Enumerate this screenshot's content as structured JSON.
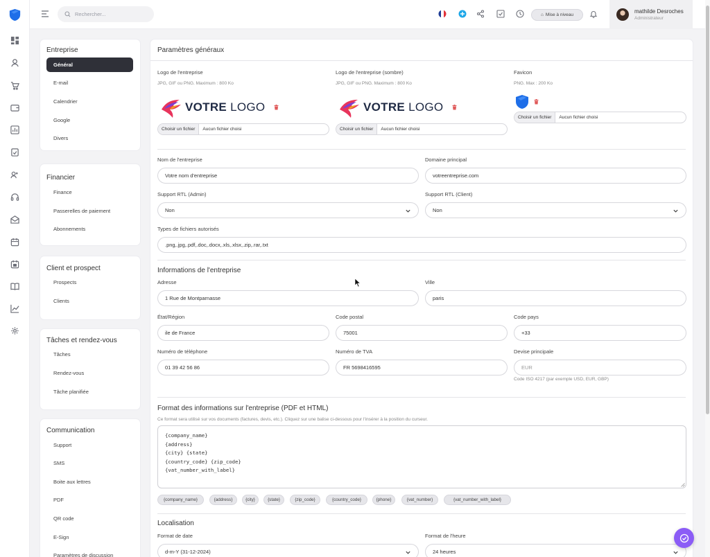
{
  "colors": {
    "accent": "#2f3038",
    "brand_blue": "#1e6ee8",
    "fab": "#8b5cf6",
    "danger": "#e05a5a",
    "upgrade_bg": "#e9e9ed"
  },
  "topbar": {
    "search_placeholder": "Rechercher...",
    "icons": [
      "flag-fr-icon",
      "plus-circle-icon",
      "share-icon",
      "check-square-icon",
      "clock-icon",
      "bell-icon"
    ],
    "upgrade_label": "Mise à niveau",
    "user": {
      "name": "mathilde Desroches",
      "role": "Administrateur"
    }
  },
  "rail": {
    "icons": [
      "dashboard-icon",
      "user-icon",
      "cart-icon",
      "wallet-icon",
      "chart-box-icon",
      "clipboard-check-icon",
      "users-icon",
      "headset-icon",
      "mail-open-icon",
      "calendar-icon",
      "calendar-check-icon",
      "book-icon",
      "line-chart-icon",
      "gear-icon"
    ]
  },
  "nav": {
    "groups": [
      {
        "title": "Entreprise",
        "items": [
          "Général",
          "E-mail",
          "Calendrier",
          "Google",
          "Divers"
        ]
      },
      {
        "title": "Financier",
        "items": [
          "Finance",
          "Passerelles de paiement",
          "Abonnements"
        ]
      },
      {
        "title": "Client et prospect",
        "items": [
          "Prospects",
          "Clients"
        ]
      },
      {
        "title": "Tâches et rendez-vous",
        "items": [
          "Tâches",
          "Rendez-vous",
          "Tâche planifiée"
        ]
      },
      {
        "title": "Communication",
        "items": [
          "Support",
          "SMS",
          "Boite aux lettres",
          "PDF",
          "QR code",
          "E-Sign",
          "Paramètres de discussion"
        ]
      }
    ]
  },
  "main": {
    "title": "Paramètres généraux",
    "logos": {
      "company_logo": {
        "label": "Logo de l'entreprise",
        "hint": "JPG, GIF ou PNG. Maximum : 800 Ko"
      },
      "company_logo_dark": {
        "label": "Logo de l'entreprise (sombre)",
        "hint": "JPG, GIF ou PNG. Maximum : 800 Ko"
      },
      "favicon": {
        "label": "Favicon",
        "hint": "PNG. Max : 200 Ko"
      },
      "logo_text_bold": "VOTRE",
      "logo_text_light": "LOGO",
      "file_button": "Choisir un fichier",
      "file_none": "Aucun fichier choisi"
    },
    "fields": {
      "company_name": {
        "label": "Nom de l'entreprise",
        "value": "Votre nom d'entreprise"
      },
      "main_domain": {
        "label": "Domaine principal",
        "value": "votreentreprise.com"
      },
      "rtl_admin": {
        "label": "Support RTL (Admin)",
        "value": "Non"
      },
      "rtl_client": {
        "label": "Support RTL (Client)",
        "value": "Non"
      },
      "file_types": {
        "label": "Types de fichiers autorisés",
        "value": ".png,.jpg,.pdf,.doc,.docx,.xls,.xlsx,.zip,.rar,.txt"
      }
    },
    "company_info": {
      "title": "Informations de l'entreprise",
      "address": {
        "label": "Adresse",
        "value": "1 Rue de Montparnasse"
      },
      "city": {
        "label": "Ville",
        "value": "paris"
      },
      "state": {
        "label": "État/Région",
        "value": "ile de France"
      },
      "zip": {
        "label": "Code postal",
        "value": "75001"
      },
      "country_code": {
        "label": "Code pays",
        "value": "+33"
      },
      "phone": {
        "label": "Numéro de téléphone",
        "value": "01 39 42 56 86"
      },
      "vat": {
        "label": "Numéro de TVA",
        "value": "FR 5698416595"
      },
      "currency": {
        "label": "Devise principale",
        "placeholder": "EUR",
        "hint": "Code ISO 4217 (par exemple USD, EUR, GBP)"
      }
    },
    "format": {
      "title": "Format des informations sur l'entreprise (PDF et HTML)",
      "hint": "Ce format sera utilisé sur vos documents (factures, devis, etc.). Cliquez sur une balise ci-dessous pour l'insérer à la position du curseur.",
      "lines": [
        "{company_name}",
        "{address}",
        "{city} {state}",
        "{country_code} {zip_code}",
        "{vat_number_with_label}"
      ],
      "tags": [
        "{company_name}",
        "{address}",
        "{city}",
        "{state}",
        "{zip_code}",
        "{country_code}",
        "{phone}",
        "{vat_number}",
        "{vat_number_with_label}"
      ]
    },
    "localisation": {
      "title": "Localisation",
      "date_format": {
        "label": "Format de date",
        "value": "d-m-Y (31-12-2024)"
      },
      "time_format": {
        "label": "Format de l'heure",
        "value": "24 heures"
      }
    }
  }
}
